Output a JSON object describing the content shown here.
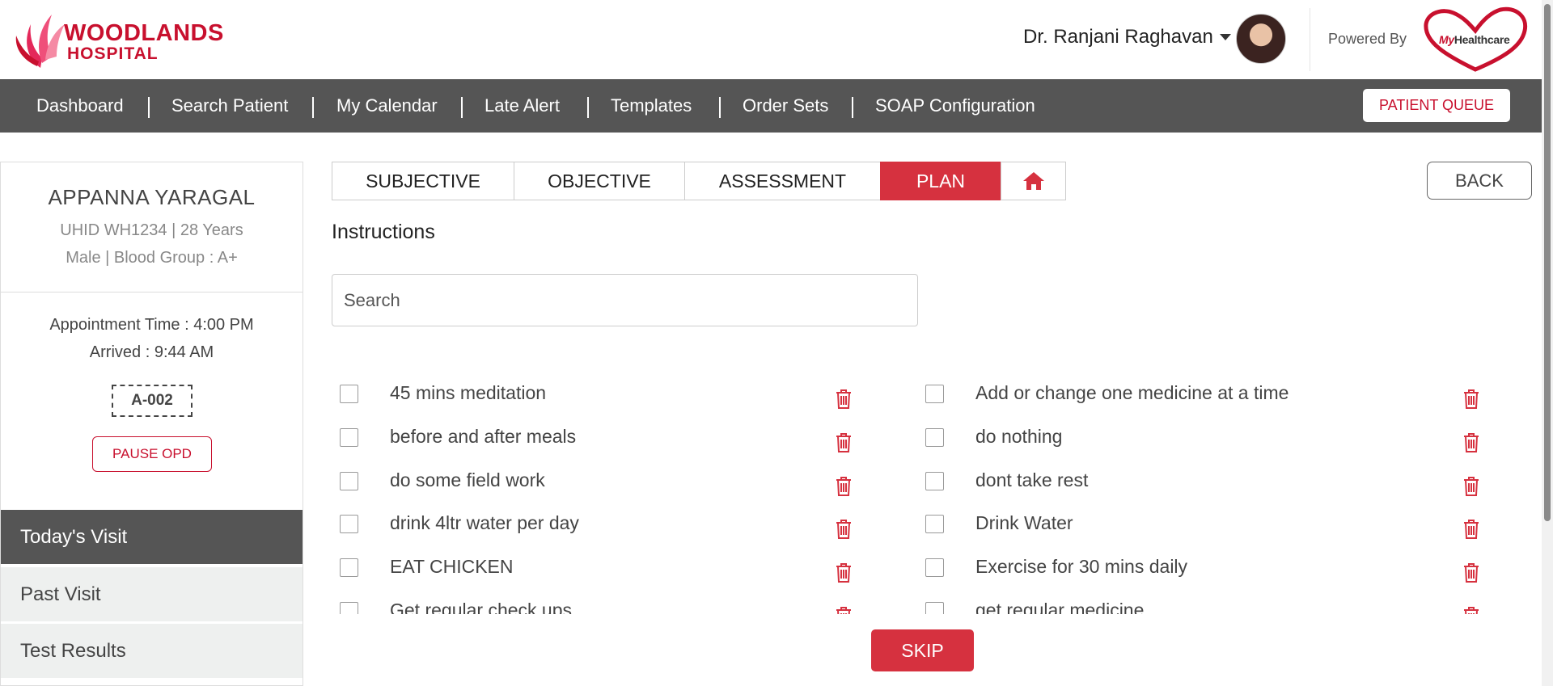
{
  "header": {
    "brand_line1": "WOODLANDS",
    "brand_line2": "HOSPITAL",
    "doctor_name": "Dr. Ranjani Raghavan",
    "powered_by": "Powered By",
    "partner_logo_my": "My",
    "partner_logo_rest": "Healthcare"
  },
  "nav": {
    "items": [
      "Dashboard",
      "Search Patient",
      "My Calendar",
      "Late Alert",
      "Templates",
      "Order Sets",
      "SOAP Configuration"
    ],
    "queue_button": "PATIENT QUEUE"
  },
  "patient": {
    "name": "APPANNA YARAGAL",
    "uhid_line": "UHID WH1234 | 28 Years",
    "gender_line": "Male | Blood Group : A+",
    "appointment_time": "Appointment Time : 4:00 PM",
    "arrived": "Arrived : 9:44 AM",
    "token": "A-002",
    "pause_button": "PAUSE OPD"
  },
  "sidebar": {
    "items": [
      "Today's Visit",
      "Past Visit",
      "Test Results"
    ]
  },
  "tabs": {
    "items": [
      "SUBJECTIVE",
      "OBJECTIVE",
      "ASSESSMENT",
      "PLAN"
    ],
    "active": "PLAN",
    "home_icon": "home-icon"
  },
  "back_button": "BACK",
  "instructions": {
    "heading": "Instructions",
    "search_placeholder": "Search",
    "left_items": [
      "45 mins meditation",
      "before and after meals",
      "do some field work",
      "drink 4ltr water per day",
      "EAT CHICKEN",
      "Get regular check ups"
    ],
    "right_items": [
      "Add or change one medicine at a time",
      "do nothing",
      "dont take rest",
      "Drink Water",
      "Exercise for 30 mins daily",
      "get regular medicine"
    ]
  },
  "skip_button": "SKIP",
  "colors": {
    "brand_red": "#c8102e",
    "active_tab": "#d6313f",
    "nav_bg": "#555555"
  }
}
